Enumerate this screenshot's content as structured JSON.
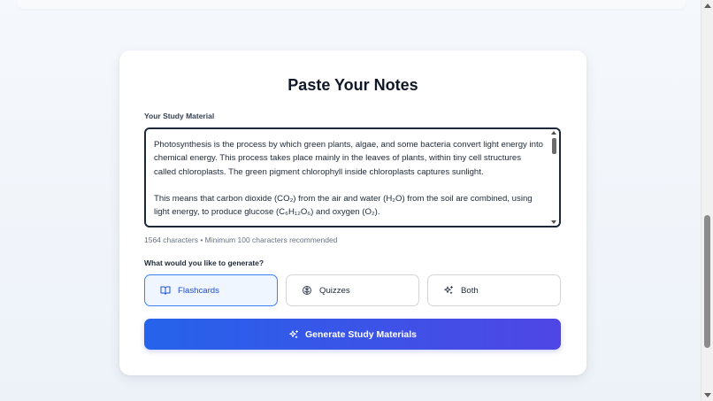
{
  "card": {
    "title": "Paste Your Notes",
    "field_label": "Your Study Material",
    "study_text": {
      "paragraph1": "Photosynthesis is the process by which green plants, algae, and some bacteria convert light energy into chemical energy. This process takes place mainly in the leaves of plants, within tiny cell structures called chloroplasts. The green pigment chlorophyll inside chloroplasts captures sunlight.",
      "paragraph2": "This means that carbon dioxide (CO₂) from the air and water (H₂O) from the soil are combined, using light energy, to produce glucose (C₆H₁₂O₆) and oxygen (O₂)."
    },
    "char_count": "1564 characters • Minimum 100 characters recommended",
    "generate_label": "What would you like to generate?",
    "options": [
      {
        "label": "Flashcards",
        "icon": "book-open-icon",
        "selected": true
      },
      {
        "label": "Quizzes",
        "icon": "brain-icon",
        "selected": false
      },
      {
        "label": "Both",
        "icon": "sparkles-icon",
        "selected": false
      }
    ],
    "generate_button": {
      "label": "Generate Study Materials",
      "icon": "sparkles-icon"
    }
  },
  "colors": {
    "accent": "#3b82f6",
    "button_gradient_start": "#2563eb",
    "button_gradient_end": "#4f46e5",
    "title": "#111827"
  }
}
